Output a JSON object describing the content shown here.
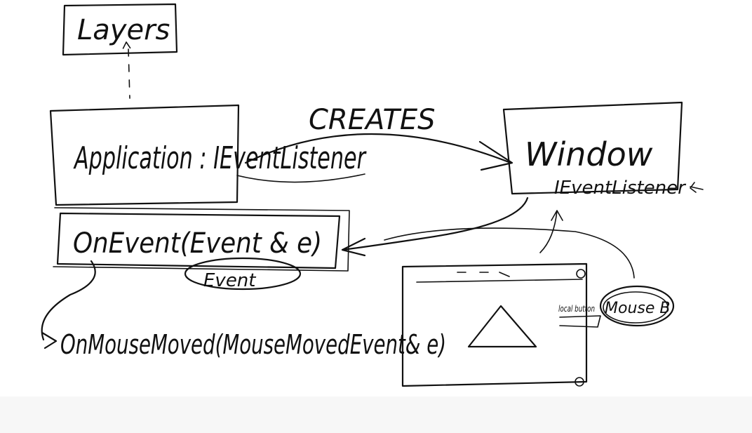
{
  "diagram": {
    "labels": {
      "layers": "Layers",
      "application": "Application : IEventListener",
      "creates": "CREATES",
      "window": "Window",
      "window_listener": "IEventListener",
      "on_event": "OnEvent(Event & e)",
      "event": "Event",
      "on_mouse_moved": "OnMouseMoved(MouseMovedEvent& e)",
      "mouse_btn": "Mouse B",
      "local_button": "local button"
    }
  }
}
